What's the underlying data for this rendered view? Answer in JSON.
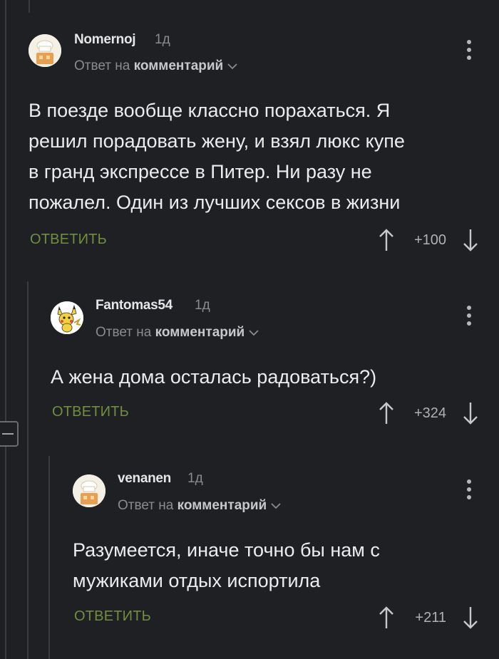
{
  "comments": [
    {
      "author": "Nomernoj",
      "age": "1д",
      "reply_prefix": "Ответ на",
      "reply_target": "комментарий",
      "text_lines": [
        "В поезде вообще классно порахаться. Я",
        "решил порадовать жену, и взял люкс купе",
        "в гранд экспрессе в Питер. Ни разу не",
        "пожалел. Один из лучших сексов в жизни"
      ],
      "reply_label": "ОТВЕТИТЬ",
      "score": "+100",
      "avatar_icon": "chef-icon"
    },
    {
      "author": "Fantomas54",
      "age": "1д",
      "reply_prefix": "Ответ на",
      "reply_target": "комментарий",
      "text_lines": [
        "А жена дома осталась радоваться?)"
      ],
      "reply_label": "ОТВЕТИТЬ",
      "score": "+324",
      "avatar_icon": "pikachu-icon"
    },
    {
      "author": "venanen",
      "age": "1д",
      "reply_prefix": "Ответ на",
      "reply_target": "комментарий",
      "text_lines": [
        "Разумеется, иначе точно бы нам с",
        "мужиками отдых испортила"
      ],
      "reply_label": "ОТВЕТИТЬ",
      "score": "+211",
      "avatar_icon": "chef-icon"
    }
  ],
  "colors": {
    "background": "#1f2024",
    "reply_green": "#6f8f3f",
    "muted": "#8a8b90"
  }
}
